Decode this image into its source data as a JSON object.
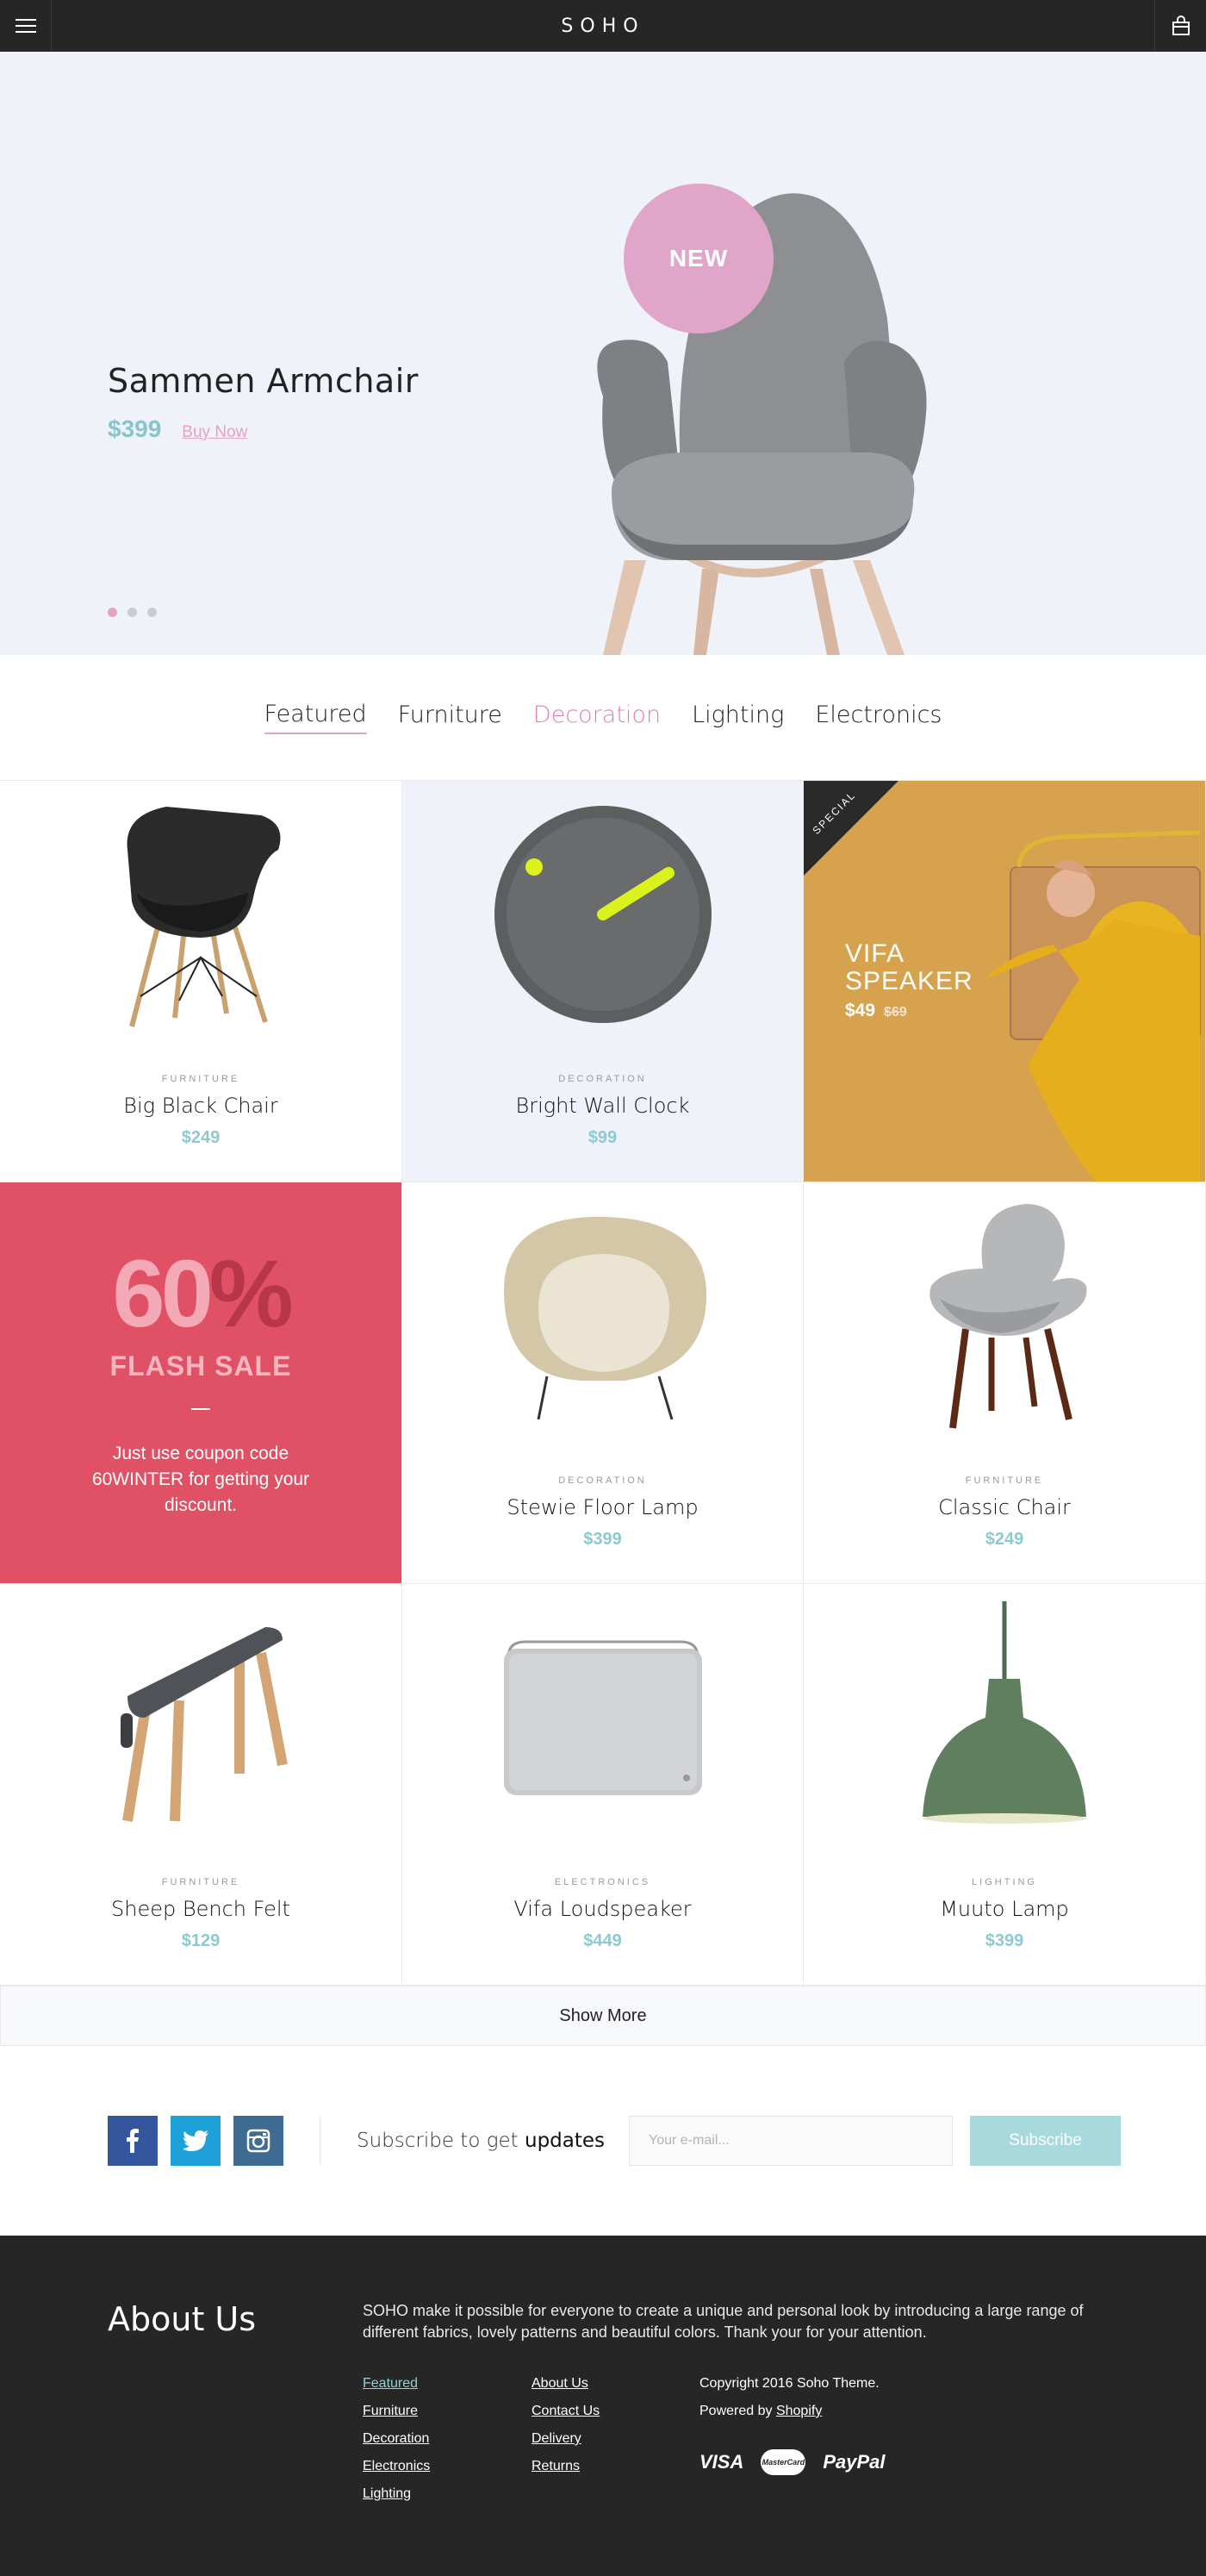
{
  "header": {
    "logo": "SOHO",
    "menu_icon": "hamburger-menu-icon",
    "cart_icon": "shopping-bag-icon"
  },
  "hero": {
    "title": "Sammen Armchair",
    "price": "$399",
    "buy_label": "Buy Now",
    "badge": "NEW",
    "slides_total": 3,
    "active_slide": 1
  },
  "tabs": [
    {
      "label": "Featured"
    },
    {
      "label": "Furniture"
    },
    {
      "label": "Decoration"
    },
    {
      "label": "Lighting"
    },
    {
      "label": "Electronics"
    }
  ],
  "products": [
    {
      "category": "FURNITURE",
      "name": "Big Black Chair",
      "price": "$249",
      "icon": "black-chair-icon"
    },
    {
      "category": "DECORATION",
      "name": "Bright Wall Clock",
      "price": "$99",
      "icon": "wall-clock-icon"
    },
    {
      "category": "DECORATION",
      "name": "Stewie Floor Lamp",
      "price": "$399",
      "icon": "floor-lamp-icon"
    },
    {
      "category": "FURNITURE",
      "name": "Classic Chair",
      "price": "$249",
      "icon": "classic-chair-icon"
    },
    {
      "category": "FURNITURE",
      "name": "Sheep Bench Felt",
      "price": "$129",
      "icon": "bench-icon"
    },
    {
      "category": "ELECTRONICS",
      "name": "Vifa Loudspeaker",
      "price": "$449",
      "icon": "loudspeaker-icon"
    },
    {
      "category": "LIGHTING",
      "name": "Muuto Lamp",
      "price": "$399",
      "icon": "pendant-lamp-icon"
    }
  ],
  "promo_speaker": {
    "ribbon": "SPECIAL",
    "title_line1": "VIFA",
    "title_line2": "SPEAKER",
    "price": "$49",
    "old_price": "$69"
  },
  "flash_sale": {
    "number": "60",
    "percent": "%",
    "title": "FLASH SALE",
    "copy": "Just use coupon code 60WINTER for getting your discount."
  },
  "show_more": "Show More",
  "subscribe": {
    "label_prefix": "Subscribe to get",
    "label_strong": "updates",
    "placeholder": "Your e-mail...",
    "button": "Subscribe",
    "social": [
      "f",
      "facebook-icon",
      "twitter-icon",
      "instagram-icon"
    ]
  },
  "footer": {
    "about_title": "About Us",
    "about_text": "SOHO make it possible for everyone to create a unique and personal look by introducing a large range of different fabrics, lovely patterns and beautiful colors. Thank your for your attention.",
    "col1": [
      "Featured",
      "Furniture",
      "Decoration",
      "Electronics",
      "Lighting"
    ],
    "col2": [
      "About Us",
      "Contact Us",
      "Delivery",
      "Returns"
    ],
    "copyright": "Copyright 2016 Soho Theme.",
    "powered_prefix": "Powered by",
    "powered_link": "Shopify",
    "payments": {
      "visa": "VISA",
      "mastercard": "MasterCard",
      "paypal": "PayPal"
    }
  },
  "colors": {
    "dark": "#262626",
    "accent_pink": "#e6a1c4",
    "accent_teal": "#8ccad0",
    "flash_red": "#e05166",
    "speaker_mustard": "#d4a04a",
    "hero_bg": "#eff2f8"
  }
}
